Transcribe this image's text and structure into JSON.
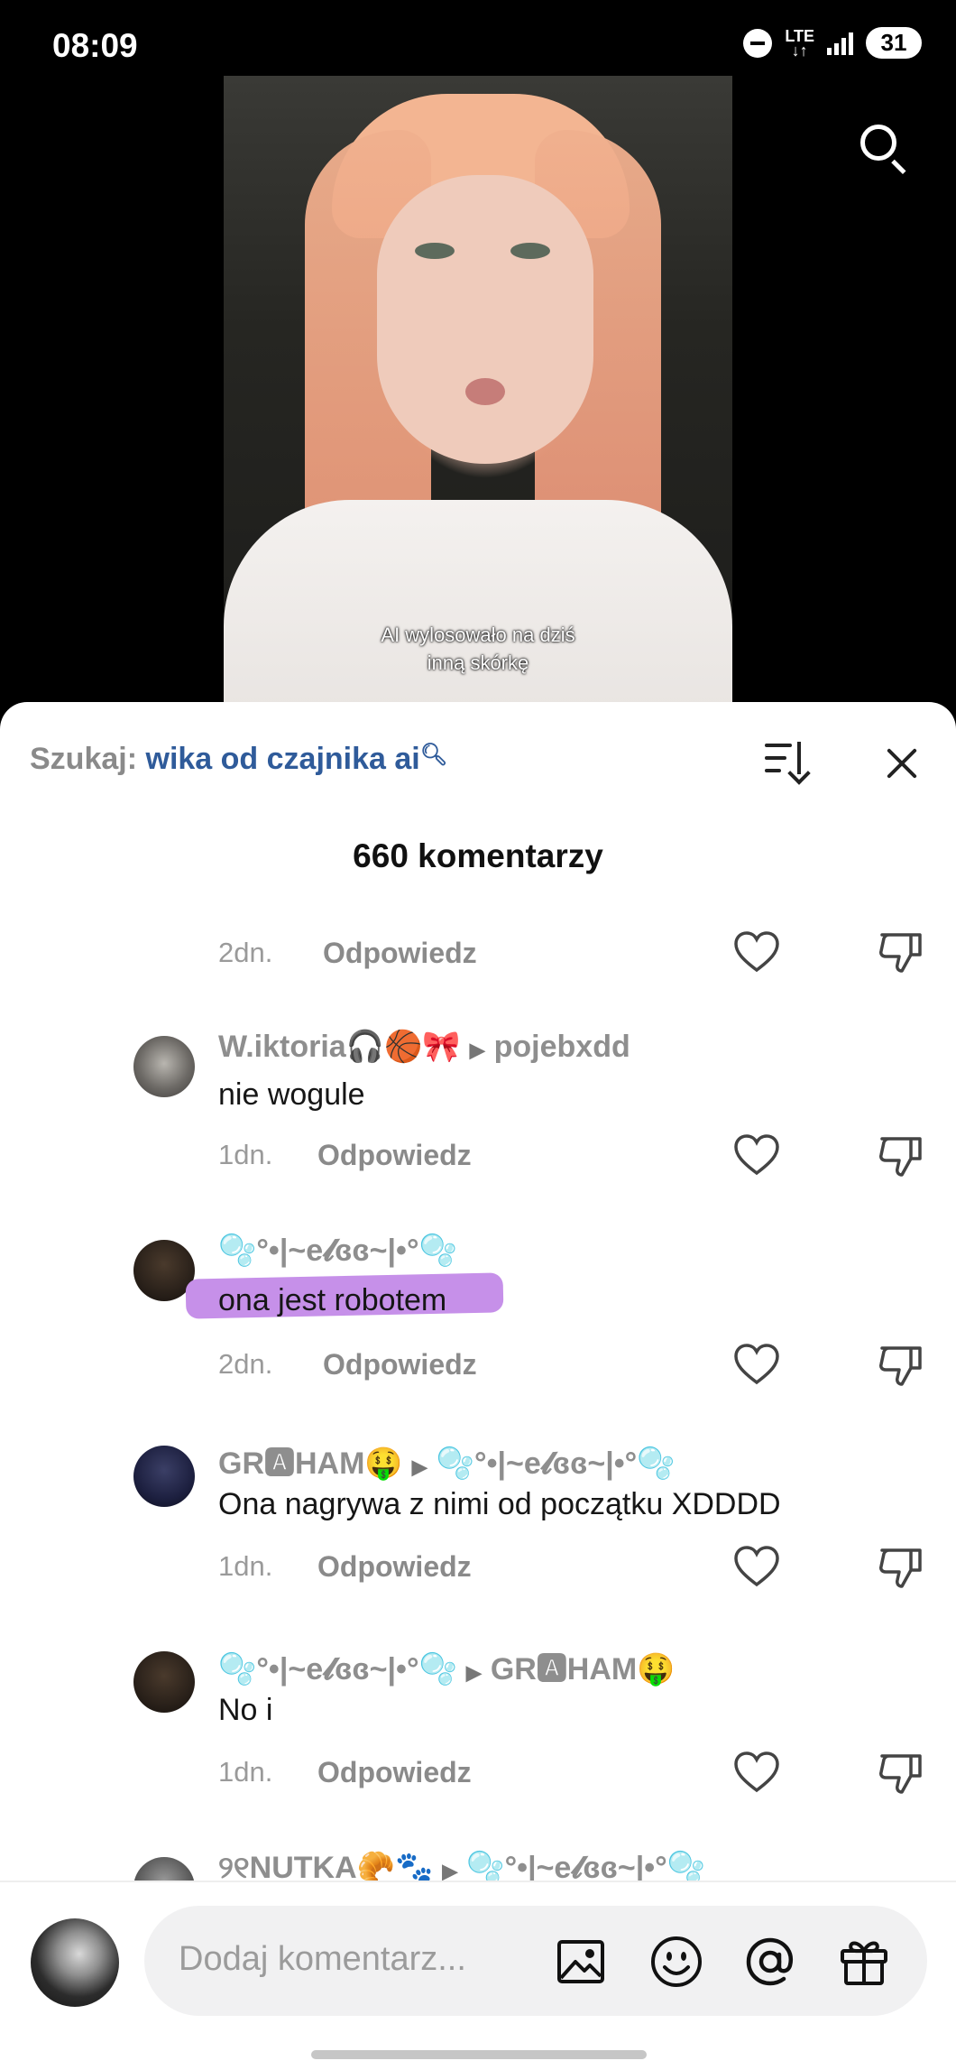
{
  "status": {
    "time": "08:09",
    "network": "LTE",
    "battery": "31"
  },
  "video": {
    "caption_line1": "AI wylosowało na dziś",
    "caption_line2": "inną skórkę"
  },
  "sheet": {
    "search_label": "Szukaj:",
    "search_query": "wika od czajnika ai",
    "comment_count": "660 komentarzy",
    "reply_label": "Odpowiedz"
  },
  "top_partial": {
    "date": "2dn."
  },
  "comments": [
    {
      "username": "W.iktoria🎧🏀🎀",
      "reply_to": "pojebxdd",
      "text": "nie wogule",
      "date": "1dn."
    },
    {
      "username": "🫧°•|~e𝓵ɞɞ~|•°🫧",
      "reply_to": "",
      "text": "ona jest robotem",
      "date": "2dn.",
      "highlighted": true
    },
    {
      "username": "GR🅰HAM🤑",
      "reply_to": "🫧°•|~e𝓵ɞɞ~|•°🫧",
      "text": "Ona nagrywa z nimi od początku XDDDD",
      "date": "1dn."
    },
    {
      "username": "🫧°•|~e𝓵ɞɞ~|•°🫧",
      "reply_to": "GR🅰HAM🤑",
      "text": "No i",
      "date": "1dn."
    },
    {
      "username": "୨୧NUTKA🥐🐾",
      "reply_to": "🫧°•|~e𝓵ɞɞ~|•°🫧",
      "text": "",
      "date": ""
    }
  ],
  "input": {
    "placeholder": "Dodaj komentarz..."
  },
  "icons": [
    "search-icon",
    "sort-icon",
    "close-icon",
    "heart-icon",
    "dislike-icon",
    "image-icon",
    "emoji-icon",
    "mention-icon",
    "gift-icon"
  ],
  "colors": {
    "query": "#2f5b9a",
    "highlight": "#c690e9",
    "muted": "#8e8e8e"
  }
}
